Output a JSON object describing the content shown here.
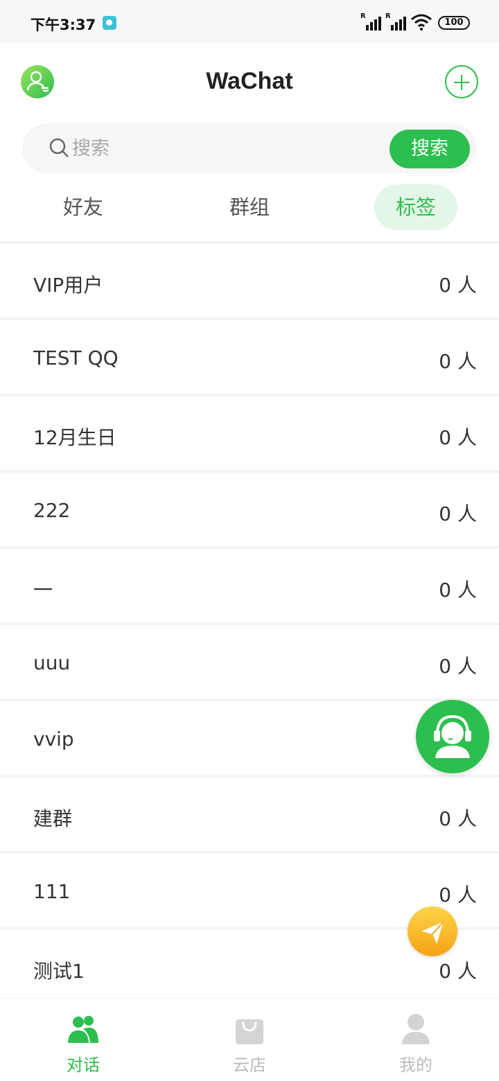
{
  "status_bar": {
    "time": "下午3:37",
    "signal_label_1": "R",
    "signal_label_2": "R",
    "battery": "100"
  },
  "header": {
    "title": "WaChat"
  },
  "search": {
    "placeholder": "搜索",
    "button_label": "搜索"
  },
  "tabs": [
    {
      "label": "好友",
      "active": false
    },
    {
      "label": "群组",
      "active": false
    },
    {
      "label": "标签",
      "active": true
    }
  ],
  "tags": [
    {
      "name": "VIP用户",
      "count": "0 人"
    },
    {
      "name": "TEST QQ",
      "count": "0 人"
    },
    {
      "name": "12月生日",
      "count": "0 人"
    },
    {
      "name": "222",
      "count": "0 人"
    },
    {
      "name": "一",
      "count": "0 人"
    },
    {
      "name": "uuu",
      "count": "0 人"
    },
    {
      "name": "vvip",
      "count": ""
    },
    {
      "name": "建群",
      "count": "0 人"
    },
    {
      "name": "111",
      "count": "0 人"
    },
    {
      "name": "测试1",
      "count": "0 人"
    }
  ],
  "bottom_nav": [
    {
      "label": "对话",
      "icon": "chat-users-icon",
      "active": true
    },
    {
      "label": "云店",
      "icon": "shopping-bag-icon",
      "active": false
    },
    {
      "label": "我的",
      "icon": "profile-icon",
      "active": false
    }
  ],
  "colors": {
    "accent": "#2cbf4f",
    "send_button": "#f5a313"
  }
}
